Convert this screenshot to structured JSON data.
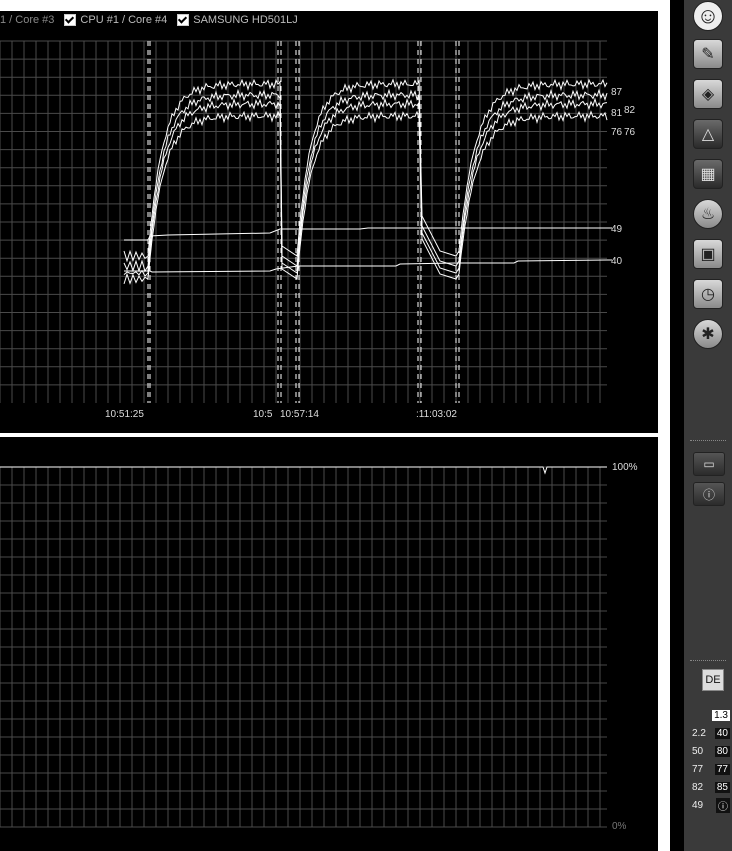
{
  "legend": [
    {
      "label": "1 / Core #3",
      "checked": false
    },
    {
      "label": "CPU #1 / Core #4",
      "checked": true
    },
    {
      "label": "SAMSUNG HD501LJ",
      "checked": true
    }
  ],
  "temp_chart": {
    "time_labels": [
      "10:51:25",
      "10:5",
      "10:57:14",
      ":11:03:02"
    ],
    "right_labels": [
      "87",
      "81",
      "82",
      "76",
      "76",
      "49",
      "40"
    ]
  },
  "usage_chart": {
    "top_label": "100%",
    "bottom_label": "0%"
  },
  "sidebar": {
    "icons": [
      "smiley-icon",
      "ase-icon",
      "memory-icon",
      "triangle-icon",
      "motherboard-icon",
      "flame-icon",
      "monitor-icon",
      "clock-icon",
      "puzzle-icon"
    ],
    "folder_button": "folder-icon",
    "info_button": "ⓘ",
    "lang": "DE",
    "tray": [
      [
        "",
        "1.3"
      ],
      [
        "2.2",
        "40"
      ],
      [
        "50",
        "80"
      ],
      [
        "77",
        "77"
      ],
      [
        "82",
        "85"
      ],
      [
        "49",
        "ⓘ"
      ]
    ]
  },
  "colors": {
    "background": "#000000",
    "grid": "#555555",
    "line": "#ffffff"
  }
}
